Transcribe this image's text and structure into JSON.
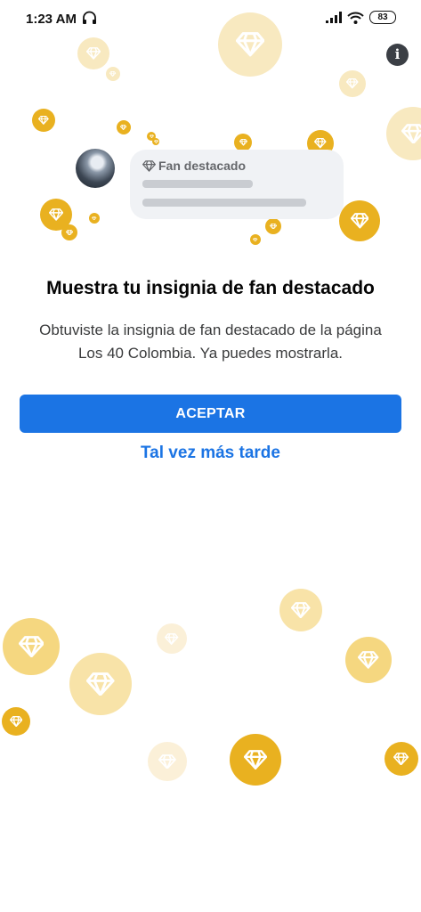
{
  "status_bar": {
    "time": "1:23 AM",
    "battery": "83"
  },
  "preview": {
    "badge_label": "Fan destacado"
  },
  "main": {
    "title": "Muestra tu insignia de fan destacado",
    "description": "Obtuviste la insignia de fan destacado de la página Los 40 Colombia. Ya puedes mostrarla."
  },
  "actions": {
    "accept_label": "ACEPTAR",
    "later_label": "Tal vez más tarde"
  },
  "colors": {
    "accent": "#1b74e4",
    "badge_gold": "#e9b120",
    "badge_light": "#f8e9c0"
  }
}
